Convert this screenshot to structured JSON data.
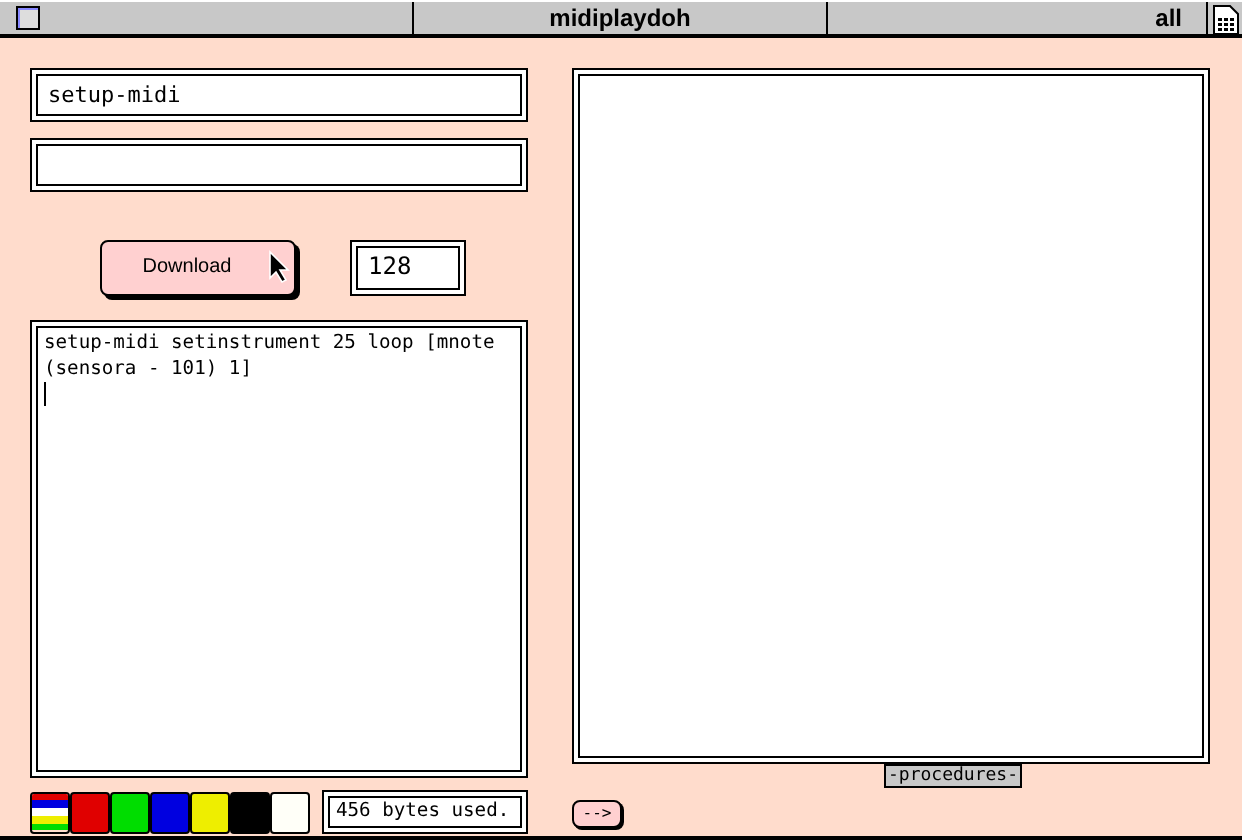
{
  "window": {
    "title": "midiplaydoh",
    "right_label": "all"
  },
  "fields": [
    {
      "value": "setup-midi"
    }
  ],
  "download_button": {
    "label": "Download"
  },
  "counter": {
    "value": "128"
  },
  "editor": {
    "lines": [
      "setup-midi setinstrument 25 loop [mnote",
      "(sensora - 101) 1]"
    ]
  },
  "palette": [
    {
      "kind": "multi"
    },
    {
      "kind": "solid",
      "color": "#e00000"
    },
    {
      "kind": "solid",
      "color": "#00dd00"
    },
    {
      "kind": "solid",
      "color": "#0000e0"
    },
    {
      "kind": "solid",
      "color": "#eeee00"
    },
    {
      "kind": "solid",
      "color": "#000000"
    },
    {
      "kind": "solid",
      "color": "#fffff8"
    }
  ],
  "status": {
    "text": "456 bytes used."
  },
  "procedures_label": "-procedures-",
  "arrow_button": {
    "label": "-->"
  }
}
